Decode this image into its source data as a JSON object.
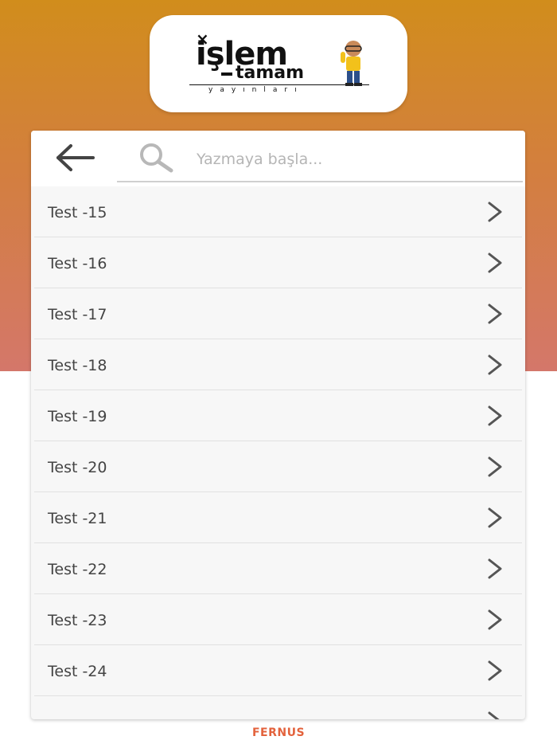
{
  "logo": {
    "x_mark": "×",
    "main_text": "işlem",
    "sub_text": "tamam",
    "small_text": "yayınları"
  },
  "search": {
    "placeholder": "Yazmaya başla...",
    "value": ""
  },
  "icons": {
    "back": "arrow-left-icon",
    "search": "search-icon",
    "row": "chevron-right-icon"
  },
  "list": {
    "items": [
      {
        "label": "Test -15"
      },
      {
        "label": "Test -16"
      },
      {
        "label": "Test -17"
      },
      {
        "label": "Test -18"
      },
      {
        "label": "Test -19"
      },
      {
        "label": "Test -20"
      },
      {
        "label": "Test -21"
      },
      {
        "label": "Test -22"
      },
      {
        "label": "Test -23"
      },
      {
        "label": "Test -24"
      },
      {
        "label": ""
      }
    ]
  },
  "footer": {
    "brand": "FERNUS"
  },
  "colors": {
    "header_top": "#d18d1c",
    "header_bottom": "#d4776a",
    "footer_brand": "#e3623c"
  }
}
